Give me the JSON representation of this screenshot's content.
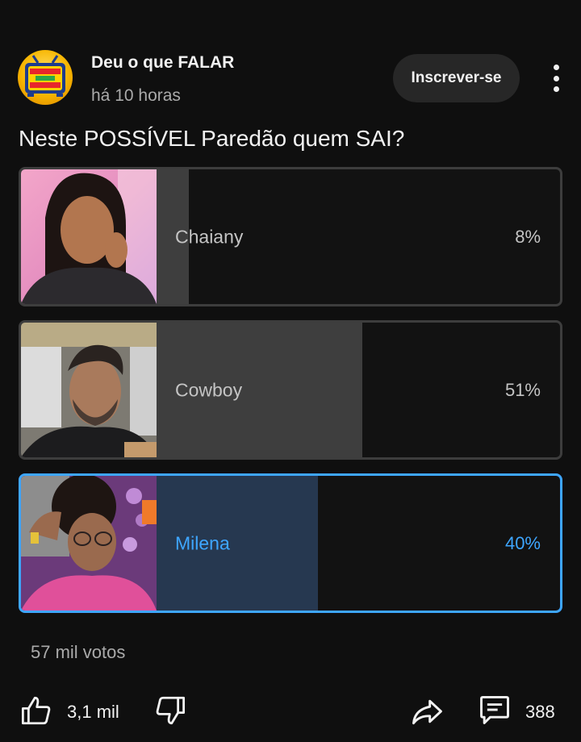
{
  "channel": {
    "name": "Deu o que FALAR",
    "time": "há 10 horas",
    "avatar_icon": "tv-logo-icon",
    "avatar_text": "DEU O QUE FALAR"
  },
  "subscribe_label": "Inscrever-se",
  "more_icon": "more-vert-icon",
  "poll": {
    "question": "Neste POSSÍVEL Paredão quem SAI?",
    "options": [
      {
        "label": "Chaiany",
        "percent": "8%",
        "fill": 0.08,
        "selected": false
      },
      {
        "label": "Cowboy",
        "percent": "51%",
        "fill": 0.51,
        "selected": false
      },
      {
        "label": "Milena",
        "percent": "40%",
        "fill": 0.4,
        "selected": true
      }
    ],
    "votes": "57 mil votos"
  },
  "actions": {
    "like_count": "3,1 mil",
    "comment_count": "388",
    "icons": [
      "thumb-up-icon",
      "thumb-down-icon",
      "share-icon",
      "comment-icon"
    ]
  },
  "colors": {
    "background": "#0f0f0f",
    "accent": "#3ea6ff",
    "bar": "#3e3e3e",
    "selected_bar": "#263850"
  }
}
